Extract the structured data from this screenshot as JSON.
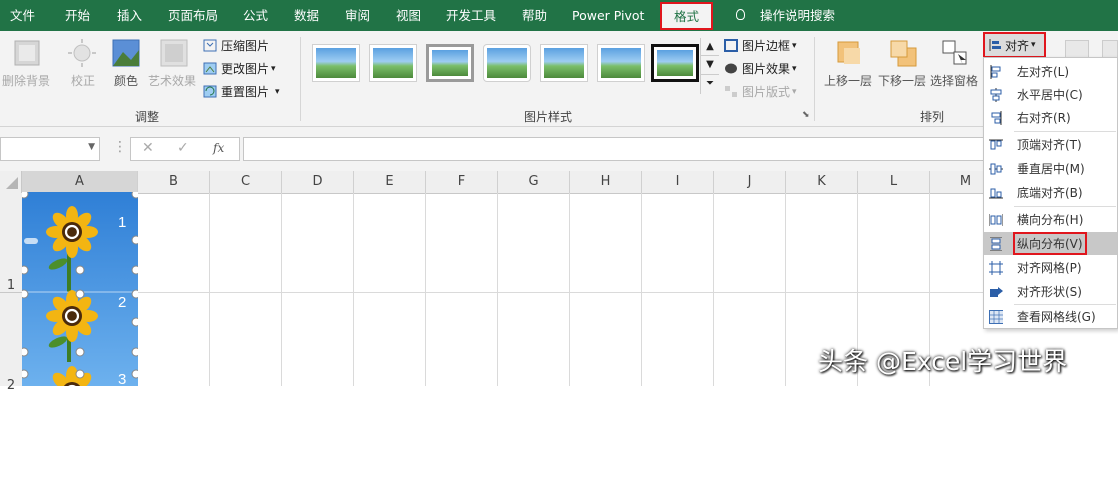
{
  "tabs": [
    "文件",
    "开始",
    "插入",
    "页面布局",
    "公式",
    "数据",
    "审阅",
    "视图",
    "开发工具",
    "帮助",
    "Power Pivot",
    "格式"
  ],
  "active_tab": "格式",
  "tell_me": "操作说明搜索",
  "ribbon": {
    "adjust": {
      "remove_bg": "删除背景",
      "correct": "校正",
      "color": "颜色",
      "art_effects": "艺术效果",
      "compress": "压缩图片",
      "change": "更改图片",
      "reset": "重置图片",
      "group_label": "调整"
    },
    "styles": {
      "border": "图片边框",
      "effects": "图片效果",
      "layout": "图片版式",
      "group_label": "图片样式"
    },
    "arrange": {
      "bring_forward": "上移一层",
      "send_backward": "下移一层",
      "selection_pane": "选择窗格",
      "align": "对齐",
      "group_label": "排列"
    }
  },
  "formula_bar": {
    "fx": "fx",
    "cancel": "✕",
    "enter": "✓"
  },
  "columns": [
    "A",
    "B",
    "C",
    "D",
    "E",
    "F",
    "G",
    "H",
    "I",
    "J",
    "K",
    "L",
    "M"
  ],
  "rows": [
    "1",
    "2"
  ],
  "image_numbers": [
    "1",
    "2",
    "3"
  ],
  "align_menu": {
    "items": [
      "左对齐(L)",
      "水平居中(C)",
      "右对齐(R)",
      "顶端对齐(T)",
      "垂直居中(M)",
      "底端对齐(B)",
      "横向分布(H)",
      "纵向分布(V)",
      "对齐网格(P)",
      "对齐形状(S)",
      "查看网格线(G)"
    ],
    "highlighted": "纵向分布(V)"
  },
  "watermark": "头条 @Excel学习世界",
  "colors": {
    "excel_green": "#217346",
    "highlight_red": "#e0161d",
    "ribbon_bg": "#f3f3f3"
  }
}
